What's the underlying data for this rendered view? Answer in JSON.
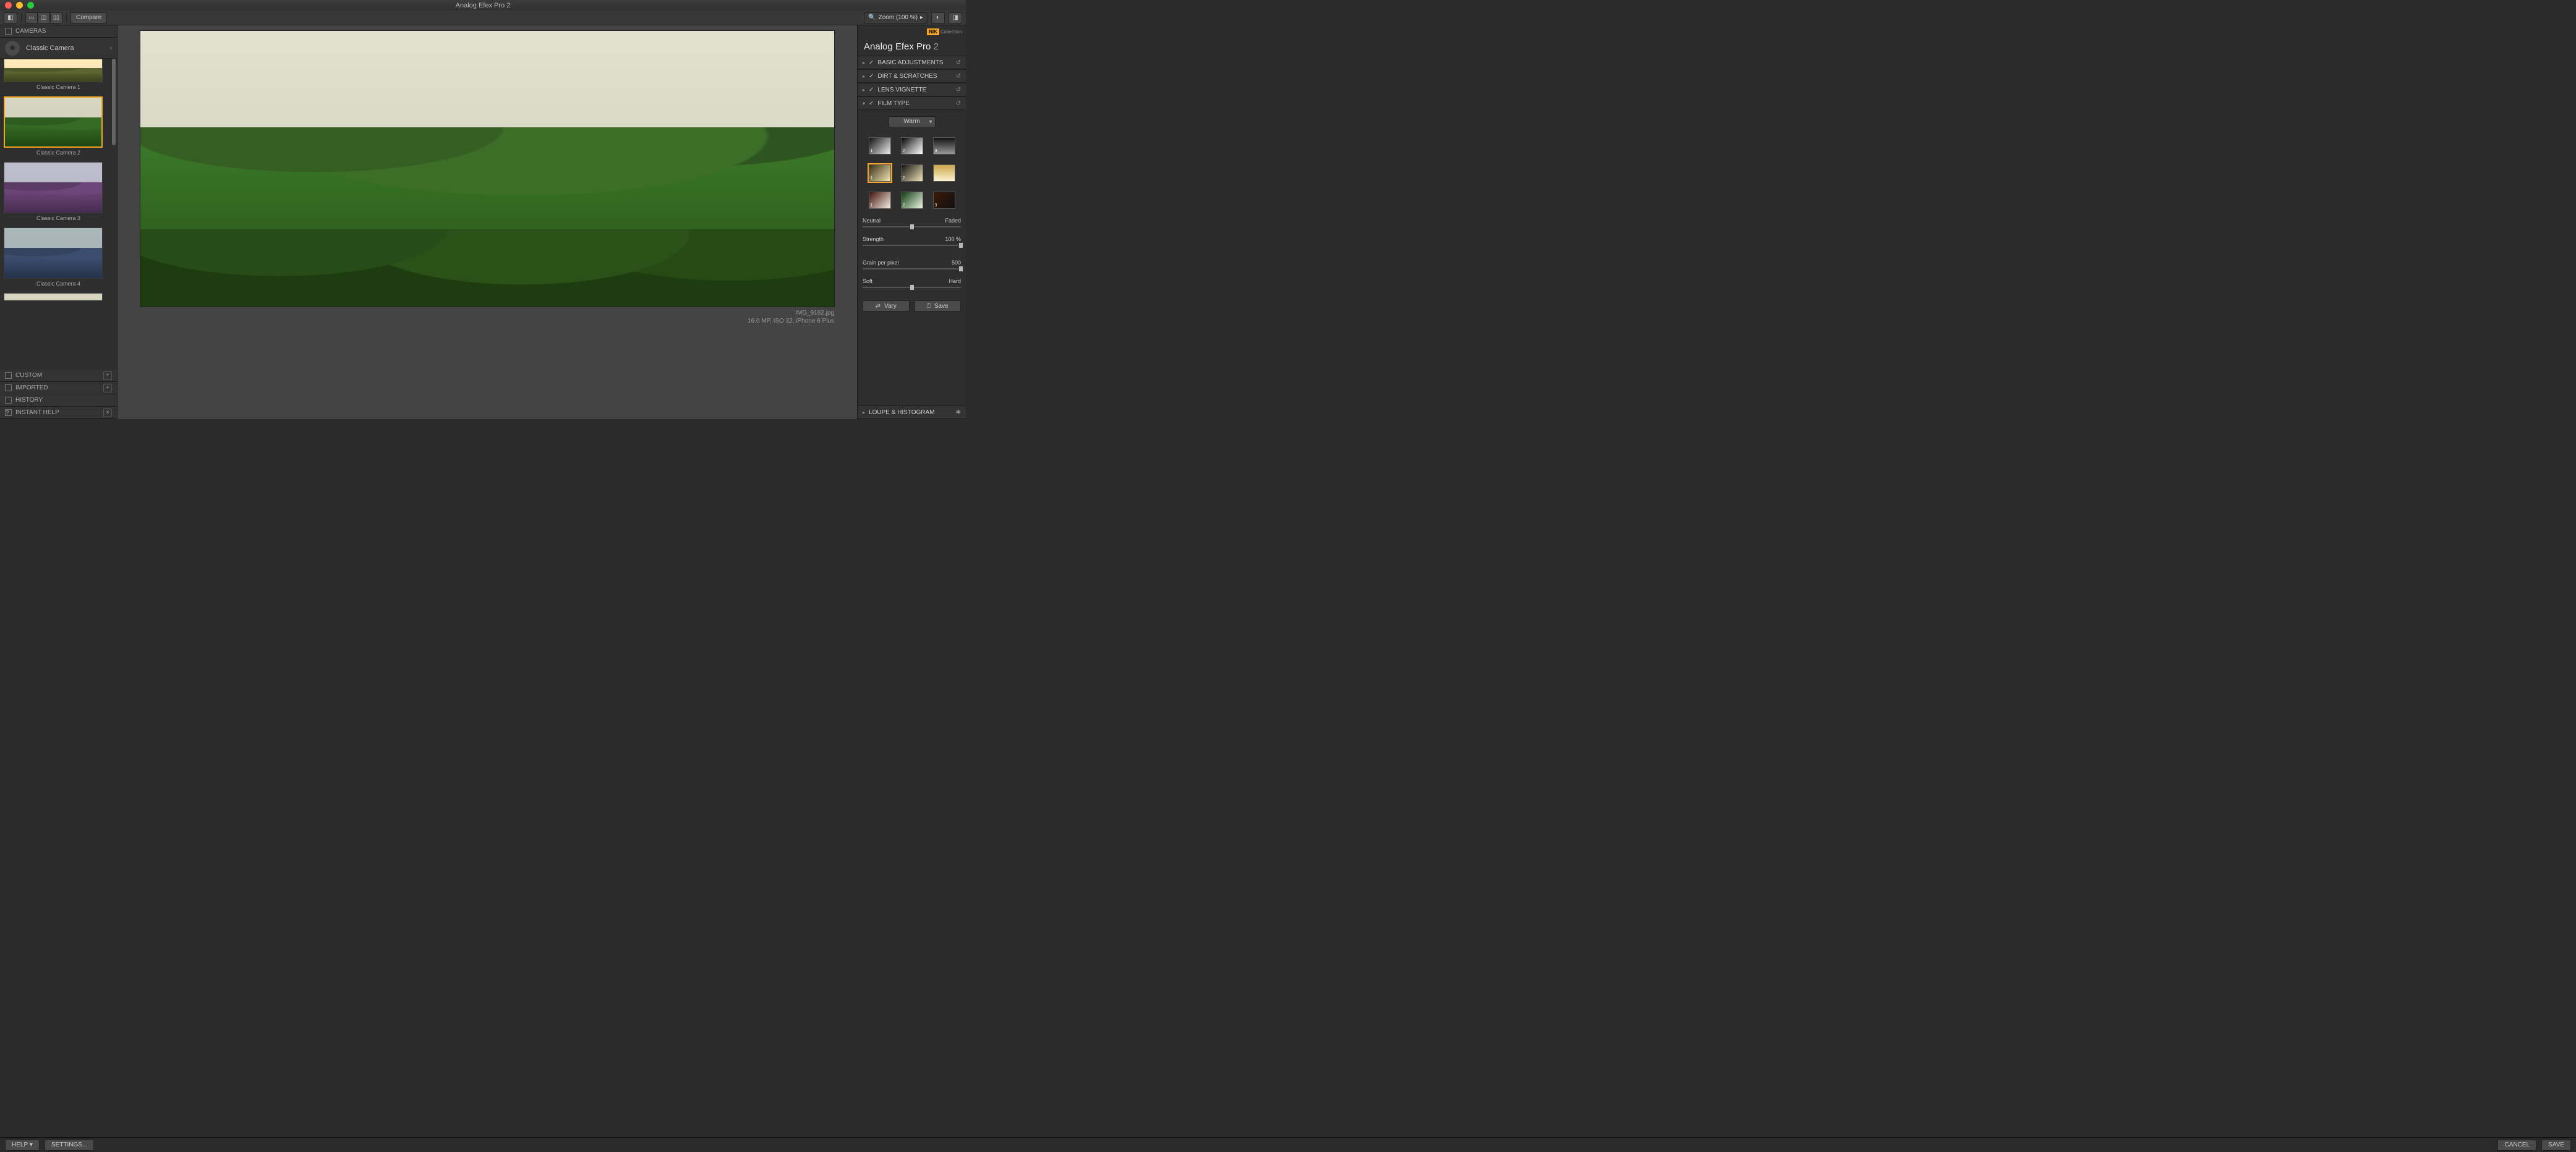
{
  "window": {
    "title": "Analog Efex Pro 2"
  },
  "toolbar": {
    "compare": "Compare",
    "zoom": "Zoom (100 %)"
  },
  "left": {
    "cameras_label": "CAMERAS",
    "current": "Classic Camera",
    "thumbs": [
      {
        "label": "Classic Camera 1"
      },
      {
        "label": "Classic Camera 2"
      },
      {
        "label": "Classic Camera 3"
      },
      {
        "label": "Classic Camera 4"
      }
    ],
    "custom": "CUSTOM",
    "imported": "IMPORTED",
    "history": "HISTORY",
    "instant_help": "INSTANT HELP"
  },
  "center": {
    "filename": "IMG_9162.jpg",
    "info": "16.0 MP, ISO 32, iPhone 6 Plus"
  },
  "right": {
    "brand_suffix": "Collection",
    "app_title": "Analog Efex Pro",
    "app_ver": "2",
    "sections": {
      "basic": "BASIC ADJUSTMENTS",
      "dirt": "DIRT & SCRATCHES",
      "vignette": "LENS VIGNETTE",
      "film": "FILM TYPE"
    },
    "film_select": "Warm",
    "swatch_nums": [
      "1",
      "2",
      "3",
      "1",
      "2",
      "3",
      "1",
      "2",
      "3"
    ],
    "sliders": {
      "neutral": {
        "left": "Neutral",
        "right": "Faded",
        "pos": 50
      },
      "strength": {
        "left": "Strength",
        "right": "100 %",
        "pos": 100
      },
      "grain": {
        "left": "Grain per pixel",
        "right": "500",
        "pos": 100
      },
      "soft": {
        "left": "Soft",
        "right": "Hard",
        "pos": 50
      }
    },
    "vary": "Vary",
    "save_preset": "Save",
    "loupe": "LOUPE & HISTOGRAM"
  },
  "bottom": {
    "help": "HELP",
    "settings": "SETTINGS...",
    "cancel": "CANCEL",
    "save": "SAVE"
  }
}
